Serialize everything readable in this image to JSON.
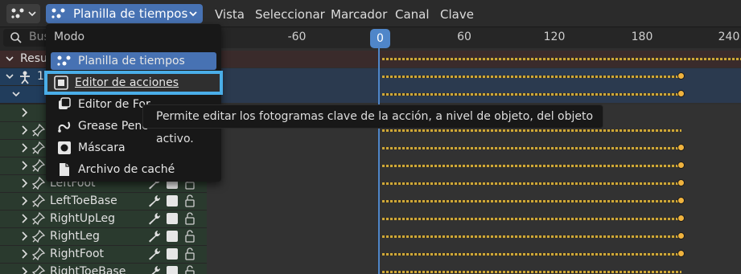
{
  "header": {
    "mode_label": "Planilla de tiempos",
    "menus": [
      "Vista",
      "Seleccionar",
      "Marcador",
      "Canal",
      "Clave"
    ]
  },
  "search": {
    "placeholder": "Bus"
  },
  "rows": [
    {
      "label": "Resu",
      "kind": "summary"
    },
    {
      "label": "1",
      "kind": "object"
    },
    {
      "label": "",
      "kind": "action"
    }
  ],
  "bones": [
    {
      "label": "LeftFoot"
    },
    {
      "label": "LeftToeBase"
    },
    {
      "label": "RightUpLeg"
    },
    {
      "label": "RightLeg"
    },
    {
      "label": "RightFoot"
    },
    {
      "label": "RightToeBase"
    }
  ],
  "ruler": {
    "ticks": [
      "-60",
      "0",
      "60",
      "120",
      "180",
      "240"
    ],
    "current_frame": "0"
  },
  "popup": {
    "title": "Modo",
    "items": [
      {
        "label": "Planilla de tiempos",
        "icon": "dopesheet-icon",
        "state": "selected"
      },
      {
        "label": "Editor de acciones",
        "icon": "action-editor-icon",
        "state": "hover"
      },
      {
        "label": "Editor de For",
        "icon": "shape-key-icon",
        "state": "normal"
      },
      {
        "label": "Grease Penc",
        "icon": "grease-pencil-icon",
        "state": "normal"
      },
      {
        "label": "Máscara",
        "icon": "mask-icon",
        "state": "normal"
      },
      {
        "label": "Archivo de caché",
        "icon": "cache-file-icon",
        "state": "normal"
      }
    ]
  },
  "tooltip": {
    "text": "Permite editar los fotogramas clave de la acción, a nivel de objeto, del objeto activo."
  },
  "colors": {
    "accent": "#4772b3",
    "highlight_border": "#4aaee8",
    "keyframe": "#f0b33e",
    "playhead": "#4f86c9",
    "summary_row": "#3d2a2a",
    "object_row": "#213d5c",
    "bone_row": "#2a3a2e"
  }
}
